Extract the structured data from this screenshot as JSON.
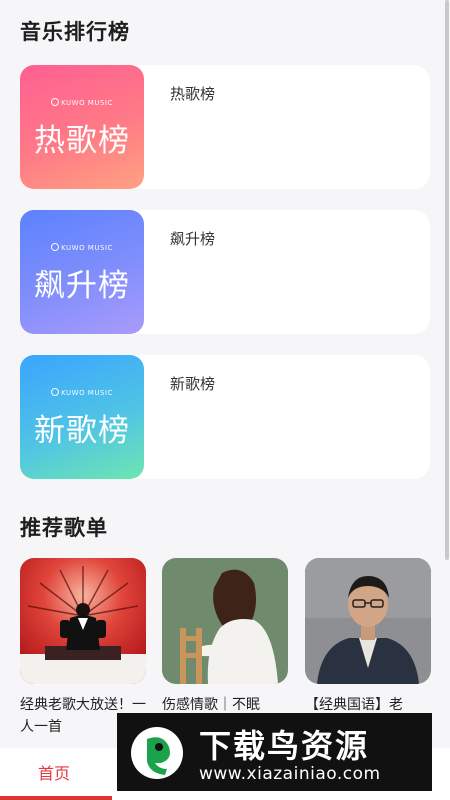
{
  "sections": {
    "rankings_title": "音乐排行榜",
    "playlists_title": "推荐歌单"
  },
  "brand": "KUWO MUSIC",
  "rankings": [
    {
      "cover_text": "热歌榜",
      "name": "热歌榜"
    },
    {
      "cover_text": "飙升榜",
      "name": "飙升榜"
    },
    {
      "cover_text": "新歌榜",
      "name": "新歌榜"
    }
  ],
  "playlists": [
    {
      "caption": "经典老歌大放送！一人一首"
    },
    {
      "caption": "伤感情歌｜不眠"
    },
    {
      "caption": "【经典国语】老"
    }
  ],
  "tabbar": {
    "home_label": "首页"
  },
  "watermark": {
    "title": "下载鸟资源",
    "url": "www.xiazainiao.com"
  },
  "colors": {
    "accent": "#e4393c",
    "background": "#f6f6f8"
  }
}
